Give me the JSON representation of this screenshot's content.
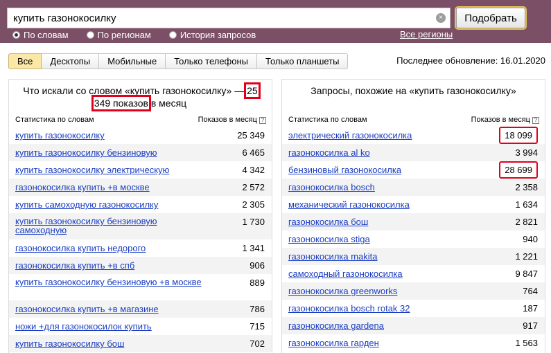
{
  "search": {
    "query": "купить газонокосилку",
    "clear_icon": "×",
    "button_label": "Подобрать"
  },
  "modes": [
    {
      "label": "По словам",
      "selected": true
    },
    {
      "label": "По регионам",
      "selected": false
    },
    {
      "label": "История запросов",
      "selected": false
    }
  ],
  "regions_link": "Все регионы",
  "tabs": [
    "Все",
    "Десктопы",
    "Мобильные",
    "Только телефоны",
    "Только планшеты"
  ],
  "updated": "Последнее обновление: 16.01.2020",
  "left": {
    "title_prefix": "Что искали со словом «купить газонокосилку» —",
    "title_highlight": "25 349 показов",
    "title_suffix": "в месяц",
    "col_keyword": "Статистика по словам",
    "col_count": "Показов в месяц",
    "rows": [
      {
        "kw": "купить газонокосилку",
        "n": "25 349"
      },
      {
        "kw": "купить газонокосилку бензиновую",
        "n": "6 465"
      },
      {
        "kw": "купить газонокосилку электрическую",
        "n": "4 342"
      },
      {
        "kw": "газонокосилка купить +в москве",
        "n": "2 572"
      },
      {
        "kw": "купить самоходную газонокосилку",
        "n": "2 305"
      },
      {
        "kw": "купить газонокосилку бензиновую самоходную",
        "n": "1 730"
      },
      {
        "kw": "газонокосилка купить недорого",
        "n": "1 341"
      },
      {
        "kw": "газонокосилка купить +в спб",
        "n": "906"
      },
      {
        "kw": "купить газонокосилку бензиновую +в москве",
        "n": "889"
      },
      {
        "kw": "газонокосилка купить +в магазине",
        "n": "786"
      },
      {
        "kw": "ножи +для газонокосилок купить",
        "n": "715"
      },
      {
        "kw": "купить газонокосилку бош",
        "n": "702"
      }
    ]
  },
  "right": {
    "title": "Запросы, похожие на «купить газонокосилку»",
    "col_keyword": "Статистика по словам",
    "col_count": "Показов в месяц",
    "rows": [
      {
        "kw": "электрический газонокосилка",
        "n": "18 099"
      },
      {
        "kw": "газонокосилка al ko",
        "n": "3 994"
      },
      {
        "kw": "бензиновый газонокосилка",
        "n": "28 699"
      },
      {
        "kw": "газонокосилка bosch",
        "n": "2 358"
      },
      {
        "kw": "механический газонокосилка",
        "n": "1 634"
      },
      {
        "kw": "газонокосилка бош",
        "n": "2 821"
      },
      {
        "kw": "газонокосилка stiga",
        "n": "940"
      },
      {
        "kw": "газонокосилка makita",
        "n": "1 221"
      },
      {
        "kw": "самоходный газонокосилка",
        "n": "9 847"
      },
      {
        "kw": "газонокосилка greenworks",
        "n": "764"
      },
      {
        "kw": "газонокосилка bosch rotak 32",
        "n": "187"
      },
      {
        "kw": "газонокосилка gardena",
        "n": "917"
      },
      {
        "kw": "газонокосилка гарден",
        "n": "1 563"
      }
    ]
  },
  "colors": {
    "topbar": "#7b4f65",
    "link": "#1a3dc1",
    "highlight": "#e0001b",
    "active_tab": "#fbe8a7"
  }
}
